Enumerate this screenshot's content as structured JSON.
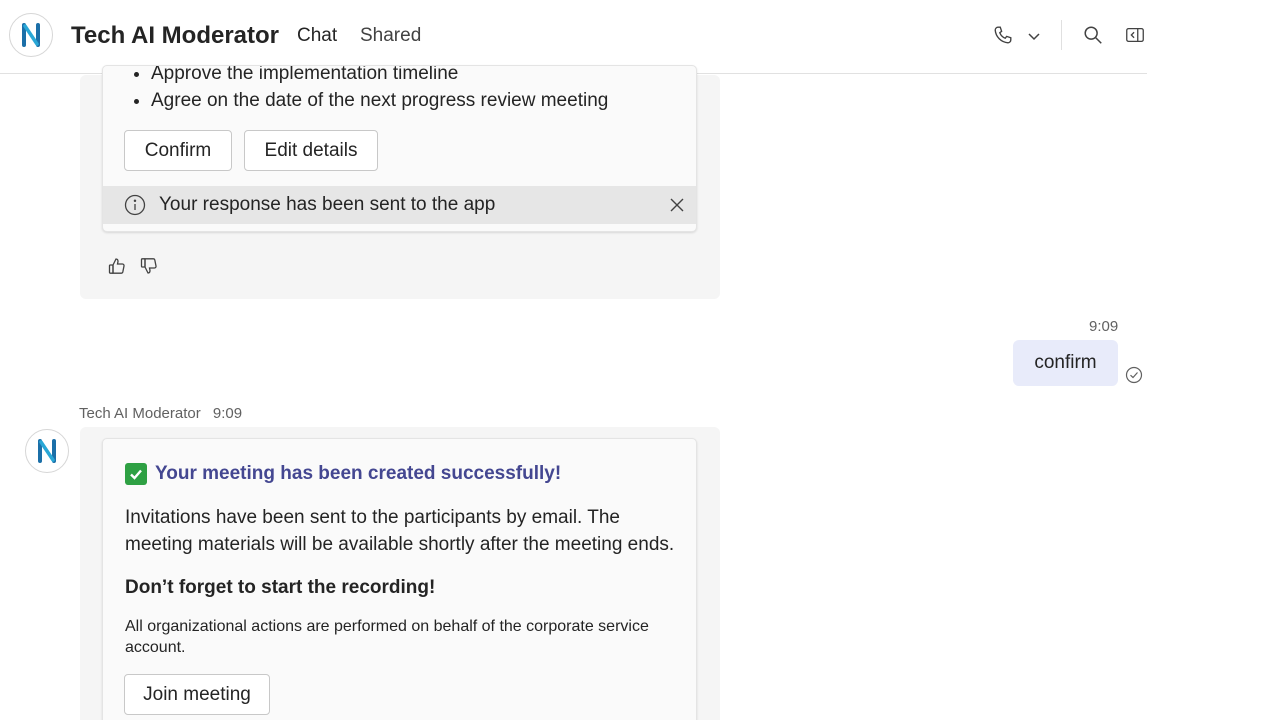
{
  "header": {
    "title": "Tech AI Moderator",
    "tabs": [
      {
        "label": "Chat",
        "active": true
      },
      {
        "label": "Shared",
        "active": false
      }
    ],
    "icons": [
      "phone-icon",
      "chevron-down-icon",
      "search-icon",
      "side-panel-icon"
    ]
  },
  "first_message": {
    "bullets": [
      "Approve the implementation timeline",
      "Agree on the date of the next progress review meeting"
    ],
    "buttons": {
      "confirm": "Confirm",
      "edit": "Edit details"
    },
    "notice": "Your response has been sent to the app"
  },
  "user_message": {
    "time": "9:09",
    "text": "confirm"
  },
  "bot_message": {
    "sender": "Tech AI Moderator",
    "time": "9:09",
    "success_title": "Your meeting has been created successfully!",
    "body": "Invitations have been sent to the participants by email. The meeting materials will be available shortly after the meeting ends.",
    "reminder": "Don’t forget to start the recording!",
    "note": "All organizational actions are performed on behalf of the corporate service account.",
    "join_button": "Join meeting"
  },
  "colors": {
    "accent": "#5b5fc7",
    "title_purple": "#444791",
    "user_bubble": "#e8ebfa",
    "check_green": "#2ea043"
  }
}
